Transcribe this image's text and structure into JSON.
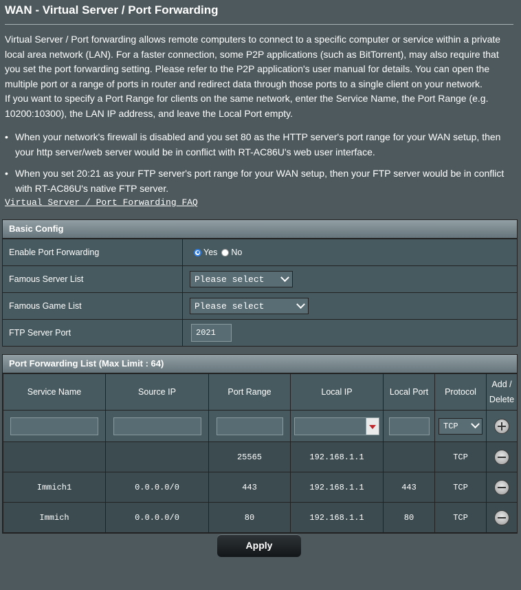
{
  "page": {
    "title": "WAN - Virtual Server / Port Forwarding",
    "desc_para1": "Virtual Server / Port forwarding allows remote computers to connect to a specific computer or service within a private local area network (LAN). For a faster connection, some P2P applications (such as BitTorrent), may also require that you set the port forwarding setting. Please refer to the P2P application's user manual for details. You can open the multiple port or a range of ports in router and redirect data through those ports to a single client on your network.",
    "desc_para2": "If you want to specify a Port Range for clients on the same network, enter the Service Name, the Port Range (e.g. 10200:10300), the LAN IP address, and leave the Local Port empty.",
    "bullets": [
      "When your network's firewall is disabled and you set 80 as the HTTP server's port range for your WAN setup, then your http server/web server would be in conflict with RT-AC86U's web user interface.",
      "When you set 20:21 as your FTP server's port range for your WAN setup, then your FTP server would be in conflict with RT-AC86U's native FTP server."
    ],
    "faq_link": "Virtual Server / Port Forwarding FAQ"
  },
  "basic_config": {
    "header": "Basic Config",
    "enable_label": "Enable Port Forwarding",
    "yes_label": "Yes",
    "no_label": "No",
    "enabled": "Yes",
    "server_list_label": "Famous Server List",
    "server_list_value": "Please select",
    "game_list_label": "Famous Game List",
    "game_list_value": "Please select",
    "ftp_port_label": "FTP Server Port",
    "ftp_port_value": "2021"
  },
  "pf_list": {
    "header": "Port Forwarding List (Max Limit : 64)",
    "columns": {
      "service_name": "Service Name",
      "source_ip": "Source IP",
      "port_range": "Port Range",
      "local_ip": "Local IP",
      "local_port": "Local Port",
      "protocol": "Protocol",
      "add_delete_1": "Add /",
      "add_delete_2": "Delete"
    },
    "new_protocol": "TCP",
    "rows": [
      {
        "service_name": "",
        "source_ip": "",
        "port_range": "25565",
        "local_ip": "192.168.1.1",
        "local_port": "",
        "protocol": "TCP"
      },
      {
        "service_name": "Immich1",
        "source_ip": "0.0.0.0/0",
        "port_range": "443",
        "local_ip": "192.168.1.1",
        "local_port": "443",
        "protocol": "TCP"
      },
      {
        "service_name": "Immich",
        "source_ip": "0.0.0.0/0",
        "port_range": "80",
        "local_ip": "192.168.1.1",
        "local_port": "80",
        "protocol": "TCP"
      }
    ]
  },
  "apply_label": "Apply"
}
